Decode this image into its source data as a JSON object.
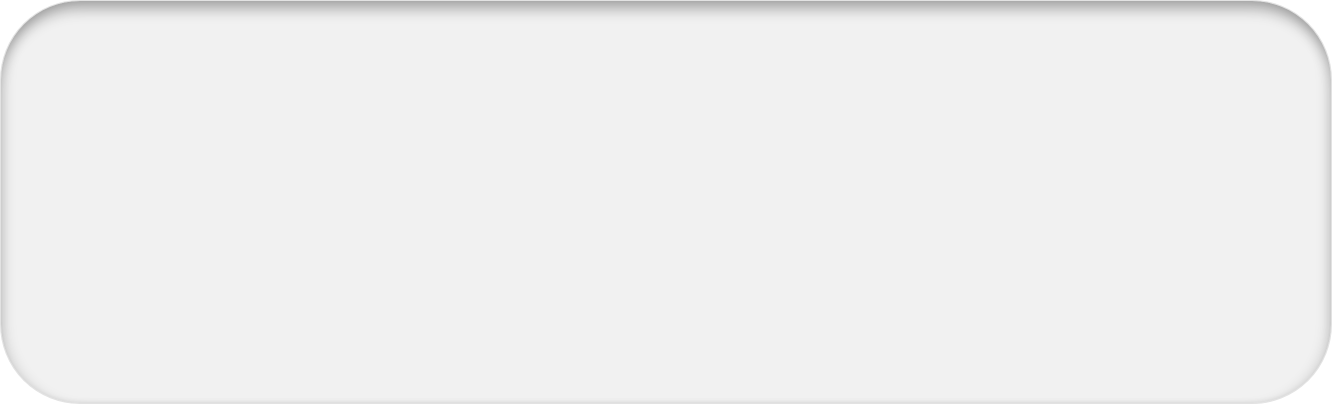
{
  "panel": {
    "background_color": "#f1f1f1",
    "content": []
  }
}
